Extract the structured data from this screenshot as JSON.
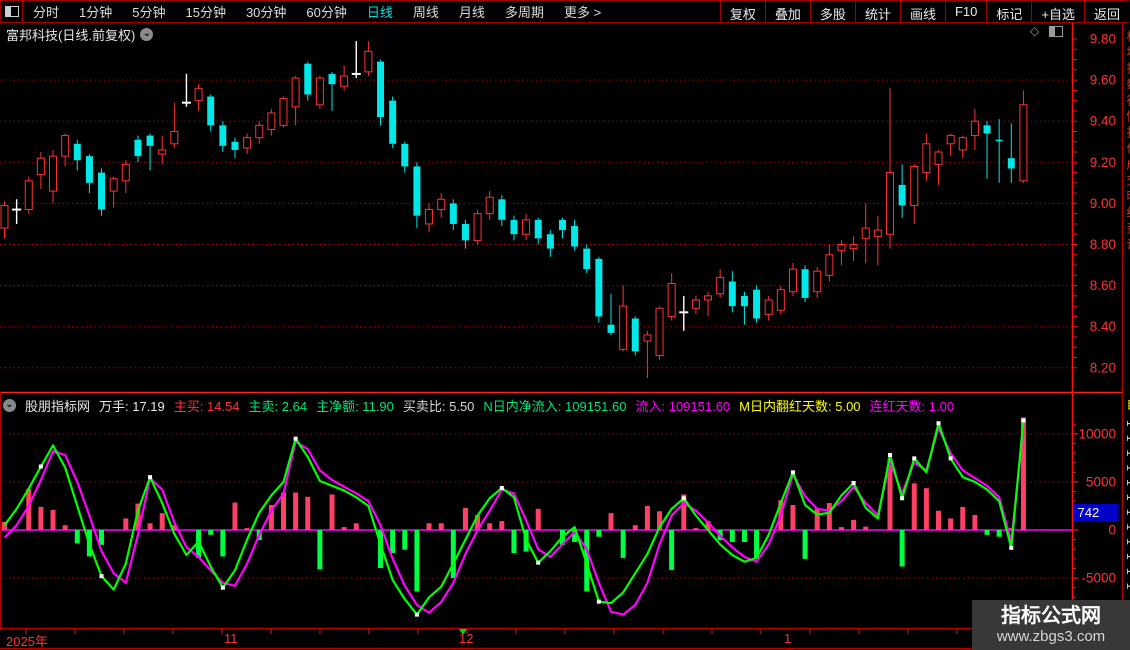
{
  "toolbar": {
    "periods": [
      "分时",
      "1分钟",
      "5分钟",
      "15分钟",
      "30分钟",
      "60分钟",
      "日线",
      "周线",
      "月线",
      "多周期",
      "更多 >"
    ],
    "active_period": "日线",
    "right_buttons": [
      "复权",
      "叠加",
      "多股",
      "统计",
      "画线",
      "F10",
      "标记",
      "+自选",
      "返回"
    ]
  },
  "title": {
    "text": "富邦科技(日线.前复权)"
  },
  "indicator_header": {
    "site": "股朋指标网",
    "fields": [
      {
        "label": "万手:",
        "value": "17.19",
        "color": "#e8e8e8"
      },
      {
        "label": "主买:",
        "value": "14.54",
        "color": "#ff3232"
      },
      {
        "label": "主卖:",
        "value": "2.64",
        "color": "#00e673"
      },
      {
        "label": "主净额:",
        "value": "11.90",
        "color": "#00e673"
      },
      {
        "label": "买卖比:",
        "value": "5.50",
        "color": "#d8d8d8"
      },
      {
        "label": "N日内净流入:",
        "value": "109151.60",
        "color": "#00e673"
      },
      {
        "label": "流入:",
        "value": "109151.60",
        "color": "#ff00ff"
      },
      {
        "label": "M日内翻红天数:",
        "value": "5.00",
        "color": "#ffff00"
      },
      {
        "label": "连红天数:",
        "value": "1.00",
        "color": "#ff00ff"
      }
    ]
  },
  "date_axis": {
    "year": "2025年",
    "months": [
      {
        "label": "11",
        "x": 224
      },
      {
        "label": "12",
        "x": 459
      },
      {
        "label": "1",
        "x": 784
      }
    ]
  },
  "watermark": {
    "line1": "指标公式网",
    "line2": "www.zbgs3.com"
  },
  "colors": {
    "up": "#ff3232",
    "down": "#00e8e8",
    "doji": "#ffffff",
    "bar_up": "#ff4066",
    "bar_down": "#00ff44",
    "line_fast": "#00ff00",
    "line_slow": "#ff00ff",
    "grid": "#b40000",
    "axis_text": "#ff3232",
    "zero_line": "#ff00ff",
    "tag_bg": "#0000c8"
  },
  "chart_data": [
    {
      "type": "candlestick",
      "title": "富邦科技(日线.前复权)",
      "ylim": [
        8.2,
        9.8
      ],
      "price_ticks": [
        "9.80",
        "9.60",
        "9.40",
        "9.20",
        "9.00",
        "8.80",
        "8.60",
        "8.40",
        "8.20"
      ],
      "grid": "dotted-horizontal",
      "candles": [
        [
          8.88,
          8.99,
          9.01,
          8.83,
          "u"
        ],
        [
          8.97,
          8.97,
          9.02,
          8.9,
          "w"
        ],
        [
          8.97,
          9.11,
          9.13,
          8.95,
          "u"
        ],
        [
          9.14,
          9.22,
          9.25,
          9.07,
          "u"
        ],
        [
          9.06,
          9.23,
          9.26,
          9.0,
          "u"
        ],
        [
          9.23,
          9.33,
          9.34,
          9.18,
          "u"
        ],
        [
          9.29,
          9.21,
          9.31,
          9.16,
          "d"
        ],
        [
          9.23,
          9.1,
          9.24,
          9.05,
          "d"
        ],
        [
          9.15,
          8.97,
          9.17,
          8.94,
          "d"
        ],
        [
          9.06,
          9.12,
          9.13,
          8.98,
          "u"
        ],
        [
          9.11,
          9.19,
          9.21,
          9.05,
          "u"
        ],
        [
          9.31,
          9.23,
          9.33,
          9.2,
          "d"
        ],
        [
          9.33,
          9.28,
          9.34,
          9.16,
          "d"
        ],
        [
          9.24,
          9.26,
          9.33,
          9.19,
          "u"
        ],
        [
          9.29,
          9.35,
          9.49,
          9.27,
          "u"
        ],
        [
          9.49,
          9.49,
          9.63,
          9.47,
          "w"
        ],
        [
          9.5,
          9.56,
          9.58,
          9.45,
          "u"
        ],
        [
          9.52,
          9.38,
          9.53,
          9.35,
          "d"
        ],
        [
          9.38,
          9.28,
          9.4,
          9.25,
          "d"
        ],
        [
          9.3,
          9.26,
          9.32,
          9.22,
          "d"
        ],
        [
          9.27,
          9.32,
          9.34,
          9.24,
          "u"
        ],
        [
          9.32,
          9.38,
          9.4,
          9.29,
          "u"
        ],
        [
          9.36,
          9.44,
          9.46,
          9.33,
          "u"
        ],
        [
          9.38,
          9.51,
          9.52,
          9.37,
          "u"
        ],
        [
          9.47,
          9.61,
          9.62,
          9.38,
          "u"
        ],
        [
          9.68,
          9.53,
          9.69,
          9.5,
          "d"
        ],
        [
          9.48,
          9.61,
          9.62,
          9.46,
          "u"
        ],
        [
          9.63,
          9.58,
          9.64,
          9.45,
          "d"
        ],
        [
          9.57,
          9.62,
          9.67,
          9.55,
          "u"
        ],
        [
          9.63,
          9.63,
          9.79,
          9.61,
          "w"
        ],
        [
          9.64,
          9.74,
          9.79,
          9.62,
          "u"
        ],
        [
          9.69,
          9.42,
          9.7,
          9.38,
          "d"
        ],
        [
          9.5,
          9.29,
          9.52,
          9.27,
          "d"
        ],
        [
          9.29,
          9.18,
          9.3,
          9.15,
          "d"
        ],
        [
          9.18,
          8.94,
          9.2,
          8.88,
          "d"
        ],
        [
          8.9,
          8.97,
          9.0,
          8.86,
          "u"
        ],
        [
          8.97,
          9.02,
          9.05,
          8.93,
          "u"
        ],
        [
          9.0,
          8.9,
          9.02,
          8.87,
          "d"
        ],
        [
          8.9,
          8.82,
          8.92,
          8.78,
          "d"
        ],
        [
          8.82,
          8.95,
          8.97,
          8.8,
          "u"
        ],
        [
          8.95,
          9.03,
          9.06,
          8.92,
          "u"
        ],
        [
          9.02,
          8.92,
          9.04,
          8.89,
          "d"
        ],
        [
          8.92,
          8.85,
          8.94,
          8.82,
          "d"
        ],
        [
          8.85,
          8.92,
          8.95,
          8.82,
          "u"
        ],
        [
          8.92,
          8.83,
          8.93,
          8.8,
          "d"
        ],
        [
          8.85,
          8.78,
          8.87,
          8.74,
          "d"
        ],
        [
          8.92,
          8.87,
          8.93,
          8.83,
          "d"
        ],
        [
          8.89,
          8.79,
          8.92,
          8.77,
          "d"
        ],
        [
          8.78,
          8.68,
          8.8,
          8.66,
          "d"
        ],
        [
          8.73,
          8.45,
          8.74,
          8.42,
          "d"
        ],
        [
          8.41,
          8.37,
          8.56,
          8.36,
          "d"
        ],
        [
          8.29,
          8.5,
          8.6,
          8.28,
          "u"
        ],
        [
          8.44,
          8.28,
          8.45,
          8.26,
          "d"
        ],
        [
          8.33,
          8.36,
          8.38,
          8.15,
          "u"
        ],
        [
          8.26,
          8.49,
          8.5,
          8.24,
          "u"
        ],
        [
          8.45,
          8.61,
          8.66,
          8.43,
          "u"
        ],
        [
          8.47,
          8.47,
          8.55,
          8.38,
          "w"
        ],
        [
          8.49,
          8.53,
          8.55,
          8.46,
          "u"
        ],
        [
          8.53,
          8.55,
          8.57,
          8.45,
          "u"
        ],
        [
          8.56,
          8.64,
          8.68,
          8.54,
          "u"
        ],
        [
          8.62,
          8.5,
          8.67,
          8.47,
          "d"
        ],
        [
          8.55,
          8.5,
          8.57,
          8.41,
          "d"
        ],
        [
          8.58,
          8.44,
          8.6,
          8.42,
          "d"
        ],
        [
          8.46,
          8.53,
          8.55,
          8.43,
          "u"
        ],
        [
          8.48,
          8.58,
          8.6,
          8.46,
          "u"
        ],
        [
          8.57,
          8.68,
          8.71,
          8.55,
          "u"
        ],
        [
          8.68,
          8.54,
          8.7,
          8.52,
          "d"
        ],
        [
          8.57,
          8.67,
          8.69,
          8.54,
          "u"
        ],
        [
          8.65,
          8.75,
          8.8,
          8.62,
          "u"
        ],
        [
          8.77,
          8.8,
          8.82,
          8.7,
          "u"
        ],
        [
          8.78,
          8.8,
          8.84,
          8.72,
          "u"
        ],
        [
          8.83,
          8.88,
          9.0,
          8.71,
          "u"
        ],
        [
          8.84,
          8.87,
          8.94,
          8.7,
          "u"
        ],
        [
          8.85,
          9.15,
          9.56,
          8.78,
          "u"
        ],
        [
          9.09,
          8.99,
          9.19,
          8.93,
          "d"
        ],
        [
          8.99,
          9.18,
          9.19,
          8.9,
          "u"
        ],
        [
          9.15,
          9.29,
          9.34,
          9.11,
          "u"
        ],
        [
          9.19,
          9.25,
          9.26,
          9.09,
          "u"
        ],
        [
          9.29,
          9.33,
          9.34,
          9.23,
          "u"
        ],
        [
          9.26,
          9.32,
          9.33,
          9.22,
          "u"
        ],
        [
          9.33,
          9.4,
          9.46,
          9.26,
          "u"
        ],
        [
          9.38,
          9.34,
          9.4,
          9.12,
          "d"
        ],
        [
          9.31,
          9.31,
          9.41,
          9.1,
          "d"
        ],
        [
          9.22,
          9.17,
          9.39,
          9.1,
          "d"
        ],
        [
          9.11,
          9.48,
          9.55,
          9.1,
          "u"
        ]
      ]
    },
    {
      "type": "bar",
      "axis_ticks": [
        "10000",
        "5000",
        "0",
        "-5000"
      ],
      "axis_values": [
        10000,
        5000,
        0,
        -5000
      ],
      "latest_tag": "742",
      "bars": [
        850,
        0,
        4300,
        2400,
        2100,
        500,
        -1400,
        -2750,
        -1550,
        0,
        1200,
        2750,
        700,
        1750,
        500,
        0,
        -2900,
        -500,
        -2750,
        2850,
        200,
        -1050,
        2600,
        3900,
        3900,
        3450,
        -4100,
        3700,
        300,
        700,
        0,
        -3950,
        -2400,
        -2050,
        -6400,
        700,
        700,
        -5000,
        2300,
        1550,
        700,
        930,
        -2400,
        -2250,
        2200,
        0,
        -1550,
        -1250,
        -6400,
        -700,
        1750,
        -2900,
        500,
        2500,
        1950,
        -4150,
        3700,
        200,
        930,
        -1050,
        -1250,
        -1250,
        -2900,
        0,
        3100,
        2600,
        -3000,
        2250,
        2800,
        300,
        1050,
        350,
        0,
        7450,
        -3800,
        4850,
        4350,
        2000,
        1200,
        2400,
        1550,
        -500,
        -700,
        200,
        11700
      ],
      "series": [
        {
          "name": "fast-green-line",
          "values": [
            500,
            2200,
            4300,
            6600,
            8800,
            6500,
            2500,
            -1500,
            -4800,
            -6200,
            -3500,
            2000,
            5500,
            2800,
            -400,
            -2600,
            -1200,
            -3800,
            -6000,
            -4200,
            -1000,
            1800,
            3600,
            5000,
            9500,
            7600,
            5100,
            4600,
            4100,
            3400,
            2500,
            -1500,
            -5200,
            -7200,
            -8800,
            -7000,
            -5900,
            -3500,
            -1000,
            1500,
            3300,
            4370,
            3400,
            -1000,
            -3400,
            -2200,
            -700,
            300,
            -3500,
            -7450,
            -7600,
            -6500,
            -4500,
            -2500,
            300,
            2200,
            3300,
            1500,
            0,
            -1500,
            -2600,
            -3300,
            -2900,
            -500,
            2800,
            6000,
            2600,
            1600,
            1800,
            3600,
            4890,
            2300,
            1200,
            7800,
            3300,
            7450,
            6000,
            11100,
            7450,
            5500,
            5000,
            4200,
            3000,
            -1850,
            11400
          ]
        },
        {
          "name": "slow-magenta-line",
          "values": [
            -800,
            500,
            2500,
            5200,
            8200,
            7800,
            5000,
            1500,
            -2200,
            -4500,
            -5500,
            -500,
            5400,
            4200,
            800,
            -1800,
            -2800,
            -4200,
            -5500,
            -5800,
            -3500,
            -500,
            2000,
            3800,
            9200,
            8400,
            6200,
            5200,
            4500,
            3800,
            3000,
            500,
            -3000,
            -5800,
            -7800,
            -8600,
            -7500,
            -5500,
            -2500,
            0,
            2000,
            4200,
            3800,
            1000,
            -2000,
            -2800,
            -1500,
            -200,
            -2000,
            -5500,
            -8500,
            -8800,
            -7800,
            -5500,
            -1500,
            1500,
            2800,
            2000,
            800,
            -600,
            -1800,
            -2800,
            -3300,
            -1500,
            1500,
            5800,
            3500,
            2200,
            2000,
            3000,
            4500,
            2800,
            1500,
            7200,
            3800,
            7000,
            6200,
            10600,
            8000,
            6200,
            5400,
            4600,
            3400,
            -1200,
            10800
          ]
        }
      ],
      "white_dots": [
        3,
        8,
        12,
        18,
        24,
        34,
        41,
        44,
        49,
        56,
        65,
        70,
        73,
        74,
        75,
        77,
        78,
        83,
        84
      ]
    }
  ]
}
